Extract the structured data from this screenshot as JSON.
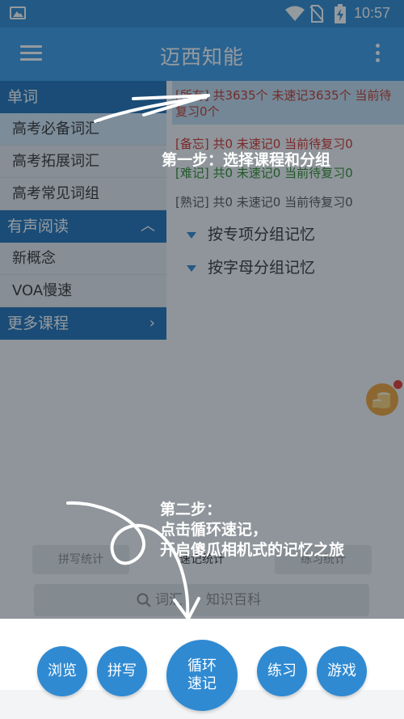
{
  "status_bar": {
    "time": "10:57"
  },
  "app_bar": {
    "title": "迈西知能"
  },
  "sidebar": {
    "sections": [
      {
        "header": "单词",
        "items": [
          "高考必备词汇",
          "高考拓展词汇",
          "高考常见词组"
        ]
      },
      {
        "header": "有声阅读",
        "items": [
          "新概念",
          "VOA慢速"
        ]
      },
      {
        "header": "更多课程",
        "items": []
      }
    ]
  },
  "stats": {
    "all": "[所有] 共3635个 未速记3635个 当前待复习0个",
    "memo": "[备忘] 共0 未速记0 当前待复习0",
    "hard": "[难记] 共0 未速记0 当前待复习0",
    "known": "[熟记] 共0 未速记0 当前待复习0"
  },
  "groups": [
    "按专项分组记忆",
    "按字母分组记忆"
  ],
  "stat_tabs": [
    "拼写统计",
    "速记统计",
    "练习统计"
  ],
  "search": {
    "text1": "词汇",
    "text2": "知识百科"
  },
  "bottom_nav": {
    "browse": "浏览",
    "spell": "拼写",
    "loop_line1": "循环",
    "loop_line2": "速记",
    "practice": "练习",
    "game": "游戏"
  },
  "tutorial": {
    "step1": "第一步：选择课程和分组",
    "step2_line1": "第二步：",
    "step2_line2": "点击循环速记，",
    "step2_line3": "开启傻瓜相机式的记忆之旅"
  },
  "colors": {
    "primary": "#3b9ce8",
    "sidebar_header": "#1f72b8",
    "accent": "#2f8ad2"
  }
}
